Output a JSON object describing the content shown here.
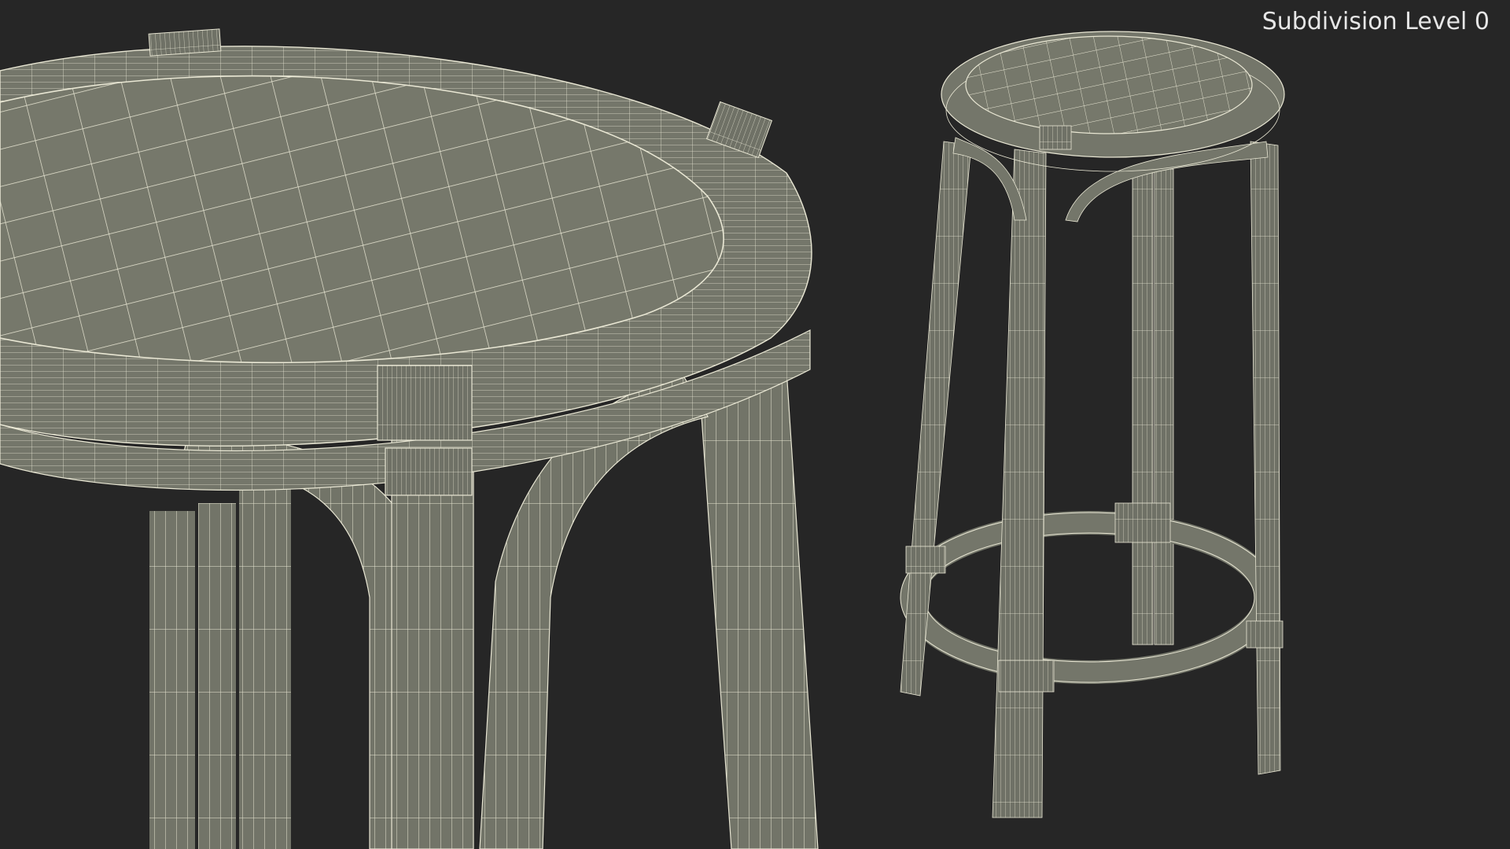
{
  "overlay": {
    "subdivision_label": "Subdivision Level 0"
  },
  "colors": {
    "background": "#262626",
    "mesh_fill": "#76786b",
    "mesh_fill_dark": "#62645a",
    "wire": "#e9e7d4"
  },
  "views": [
    {
      "name": "closeup-view",
      "subject": "bar stool seat and leg joints"
    },
    {
      "name": "full-view",
      "subject": "rattan bar stool"
    }
  ]
}
